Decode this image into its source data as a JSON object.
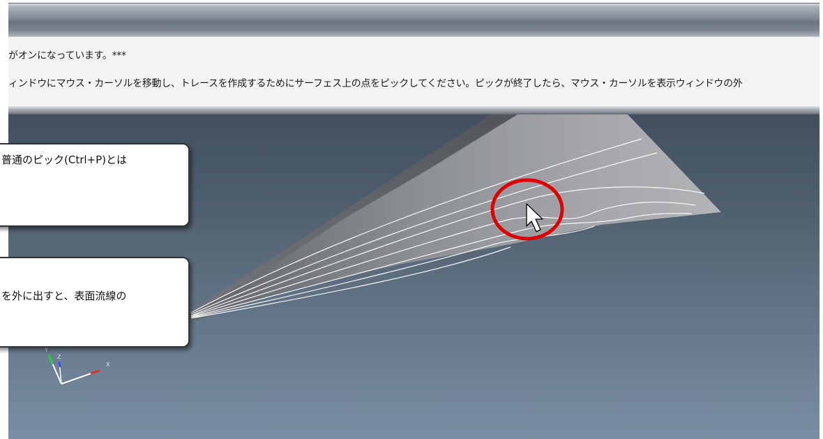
{
  "console": {
    "line1": "がオンになっています。***",
    "line2": "ィンドウにマウス・カーソルを移動し、トレースを作成するためにサーフェス上の点をピックしてください。ピックが終了したら、マウス・カーソルを表示ウィンドウの外"
  },
  "callouts": {
    "first": "普通のピック(Ctrl+P)とは",
    "second": "を外に出すと、表面流線の"
  },
  "axes": {
    "x_label": "X",
    "y_label": "Y",
    "z_label": "Z"
  },
  "colors": {
    "highlight_circle": "#e00000",
    "streamline": "#ffffff",
    "surface": "#a0a0a0"
  },
  "icons": {
    "cursor": "mouse-pointer-icon"
  }
}
